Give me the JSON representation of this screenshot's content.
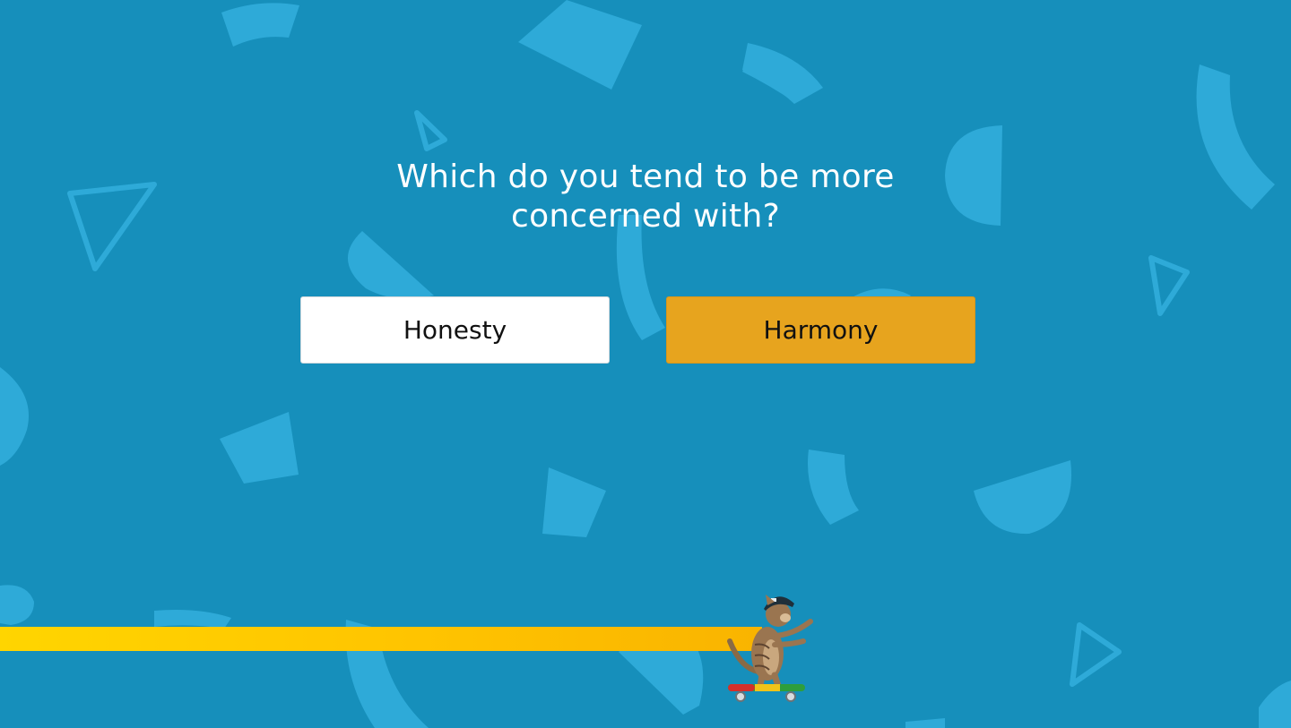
{
  "quiz": {
    "question": "Which do you tend to be more concerned with?",
    "answers": [
      {
        "label": "Honesty"
      },
      {
        "label": "Harmony"
      }
    ]
  },
  "progress": {
    "percent": 59
  },
  "colors": {
    "background": "#168fbb",
    "confetti": "#2eaad8",
    "selected_answer": "#e7a41e",
    "progress_bar": "#ffc400"
  },
  "icons": {
    "mascot": "skateboarding-cat-icon"
  }
}
